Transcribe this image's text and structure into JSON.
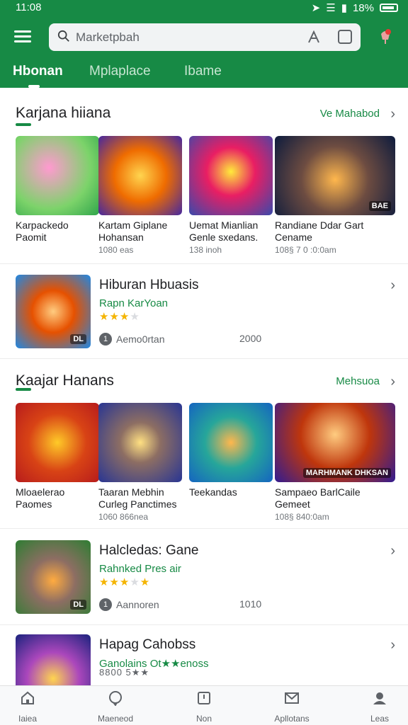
{
  "status": {
    "time": "11:08",
    "battery": "18%"
  },
  "search": {
    "placeholder": "Marketpbah"
  },
  "tabs": [
    {
      "label": "Hbonan"
    },
    {
      "label": "Mplaplace"
    },
    {
      "label": "Ibame"
    }
  ],
  "section1": {
    "title": "Karjana hiiana",
    "more": "Ve Mahabod",
    "cards": [
      {
        "name": "Karpackedo Paomit",
        "meta": ""
      },
      {
        "name": "Kartam Giplane Hohansan",
        "meta": "1080 eas"
      },
      {
        "name": "Uemat Mianlian Genle sxedans.",
        "meta": "138 inoh"
      },
      {
        "name": "Randiane Ddar Gart Cename",
        "meta": "108§ 7 0 :0:0am",
        "badge": "BAE"
      }
    ]
  },
  "feature1": {
    "title": "Hiburan Hbuasis",
    "subtitle": "Rapn KarYoan",
    "stars": 3,
    "developer": "Aemo0rtan",
    "count": "2000",
    "badge": "DL"
  },
  "section2": {
    "title": "Kaajar Hanans",
    "more": "Mehsuoa",
    "cards": [
      {
        "name": "Mloaelerao Paomes",
        "meta": ""
      },
      {
        "name": "Taaran Mebhin Curleg Panctimes",
        "meta": "1060 866nea"
      },
      {
        "name": "Teekandas",
        "meta": ""
      },
      {
        "name": "Sampaeo BarlCaile Gemeet",
        "meta": "108§ 840:0am",
        "badge": "MARHMANK DHKSAN"
      }
    ]
  },
  "feature2": {
    "title": "Halcledas: Gane",
    "subtitle": "Rahnked Pres air",
    "stars": 3,
    "developer": "Aannoren",
    "count": "1010",
    "badge": "DL"
  },
  "feature3": {
    "title": "Hapag Cahobss",
    "subtitle": "Ganolains Ot★★enoss",
    "meta": "8800 5★★"
  },
  "bottomnav": [
    {
      "label": "Iaiea"
    },
    {
      "label": "Maeneod"
    },
    {
      "label": "Non"
    },
    {
      "label": "Apllotans"
    },
    {
      "label": "Leas"
    }
  ],
  "colors": {
    "brand": "#178a45",
    "star": "#f4b400"
  }
}
